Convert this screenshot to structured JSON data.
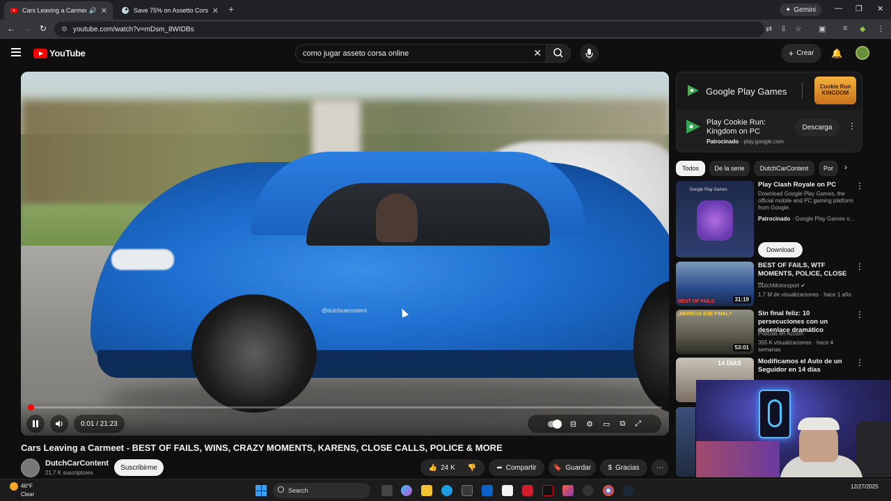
{
  "browser": {
    "tabs": [
      {
        "title": "Cars Leaving a Carmeet - BEST",
        "active": true
      },
      {
        "title": "Save 75% on Assetto Corsa on",
        "active": false
      }
    ],
    "gemini_label": "Gemini",
    "url": "youtube.com/watch?v=mDsm_8WIDBs"
  },
  "youtube": {
    "logo_text": "YouTube",
    "search_query": "como jugar asseto corsa online",
    "create_label": "Crear"
  },
  "player": {
    "watermark": "@dutchcarcontent",
    "time": "0:01 / 21:23",
    "progress_fraction": 0.001
  },
  "video": {
    "title": "Cars Leaving a Carmeet - BEST OF FAILS, WINS, CRAZY MOMENTS, KARENS, CLOSE CALLS, POLICE & MORE",
    "channel": "DutchCarContent",
    "subscribers": "21,7 K suscriptores",
    "subscribe_label": "Suscribirme",
    "likes": "24 K",
    "share_label": "Compartir",
    "save_label": "Guardar",
    "thanks_label": "Gracias"
  },
  "ad": {
    "brand": "Google Play Games",
    "kingdom_label": "Cookie Run KINGDOM",
    "title": "Play Cookie Run: Kingdom on PC",
    "sponsored": "Patrocinado",
    "domain": "play.google.com",
    "cta": "Descarga"
  },
  "chips": [
    "Todos",
    "De la serie",
    "DutchCarContent",
    "Por"
  ],
  "recommendations": [
    {
      "title": "Play Clash Royale on PC",
      "desc": "Download Google Play Games, the official mobile and PC gaming platform from Google.",
      "sponsored": "Patrocinado",
      "source": "Google Play Games o...",
      "cta": "Download",
      "thumb_label": "Google Play Games"
    },
    {
      "title": "BEST OF FAILS, WTF MOMENTS, POLICE, CLOSE ...",
      "channel": "DutchMotorsport",
      "meta": "1,7 M de visualizaciones · hace 1 año",
      "duration": "31:19",
      "thumb_label": "BEST OF FAILS"
    },
    {
      "title": "Sin final feliz: 10 persecuciones con un desenlace dramático",
      "channel": "Policías en Acción",
      "meta": "355 K visualizaciones · hace 4 semanas",
      "duration": "53:01",
      "thumb_label": "¡MERECÍA ESE FINAL?"
    },
    {
      "title": "Modificamos el Auto de un Seguidor en 14 días",
      "thumb_label": "14 DÍAS"
    }
  ],
  "taskbar": {
    "temperature": "46°F",
    "condition": "Clear",
    "search_label": "Search",
    "date": "12/27/2025"
  },
  "colors": {
    "brand_red": "#ff0000",
    "background": "#0f0f0f"
  }
}
